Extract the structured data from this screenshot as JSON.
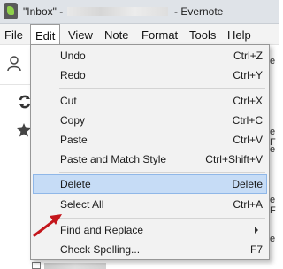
{
  "window": {
    "title_prefix": "\"Inbox\" -",
    "app_name": "- Evernote"
  },
  "menubar": {
    "items": [
      "File",
      "Edit",
      "View",
      "Note",
      "Format",
      "Tools",
      "Help"
    ],
    "open_menu": "Edit"
  },
  "edit_menu": {
    "items": [
      {
        "label": "Undo",
        "shortcut": "Ctrl+Z"
      },
      {
        "label": "Redo",
        "shortcut": "Ctrl+Y"
      },
      {
        "label": "Cut",
        "shortcut": "Ctrl+X"
      },
      {
        "label": "Copy",
        "shortcut": "Ctrl+C"
      },
      {
        "label": "Paste",
        "shortcut": "Ctrl+V"
      },
      {
        "label": "Paste and Match Style",
        "shortcut": "Ctrl+Shift+V"
      },
      {
        "label": "Delete",
        "shortcut": "Delete",
        "highlighted": true
      },
      {
        "label": "Select All",
        "shortcut": "Ctrl+A"
      },
      {
        "label": "Find and Replace",
        "shortcut": "",
        "submenu": true
      },
      {
        "label": "Check Spelling...",
        "shortcut": "F7"
      }
    ]
  },
  "background": {
    "right_edge_letters": [
      "e",
      "e F",
      "e",
      "e F",
      "e",
      "e"
    ]
  },
  "colors": {
    "highlight_bg": "#c6dcf6",
    "highlight_border": "#8fb7e8",
    "annotation_arrow": "#c4161c",
    "evernote_green": "#8fd14a"
  },
  "icons": {
    "app": "evernote-elephant-icon",
    "contacts": "person-icon",
    "sync": "sync-icon",
    "shortcuts": "star-icon",
    "annotation": "red-arrow-icon"
  }
}
